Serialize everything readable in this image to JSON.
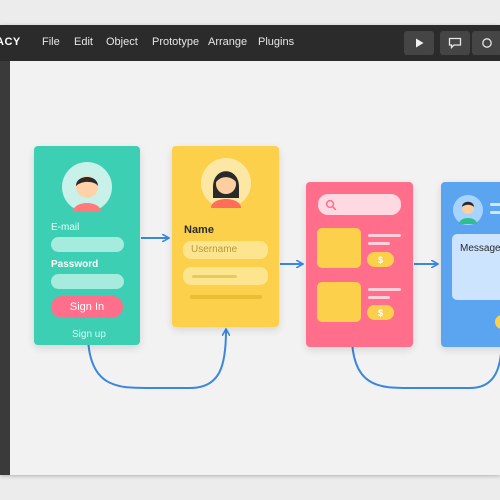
{
  "app": {
    "brand": "ACY"
  },
  "menu": [
    "File",
    "Edit",
    "Object",
    "Prototype",
    "Arrange",
    "Plugins"
  ],
  "toolbar": {
    "play_icon": "play-icon",
    "comment_icon": "comment-icon",
    "share_icon": "share-icon"
  },
  "login_card": {
    "email_label": "E-mail",
    "password_label": "Password",
    "signin_label": "Sign In",
    "signup_label": "Sign up"
  },
  "profile_card": {
    "name_label": "Name",
    "username_placeholder": "Username"
  },
  "shop_card": {
    "price_symbol": "$"
  },
  "chat_card": {
    "message_label": "Message"
  },
  "colors": {
    "login": "#3ccfb4",
    "profile": "#fcd04a",
    "shop": "#ff6e8a",
    "chat": "#5aa4f0",
    "connector": "#3a86e0",
    "menubar": "#2b2b2b"
  }
}
